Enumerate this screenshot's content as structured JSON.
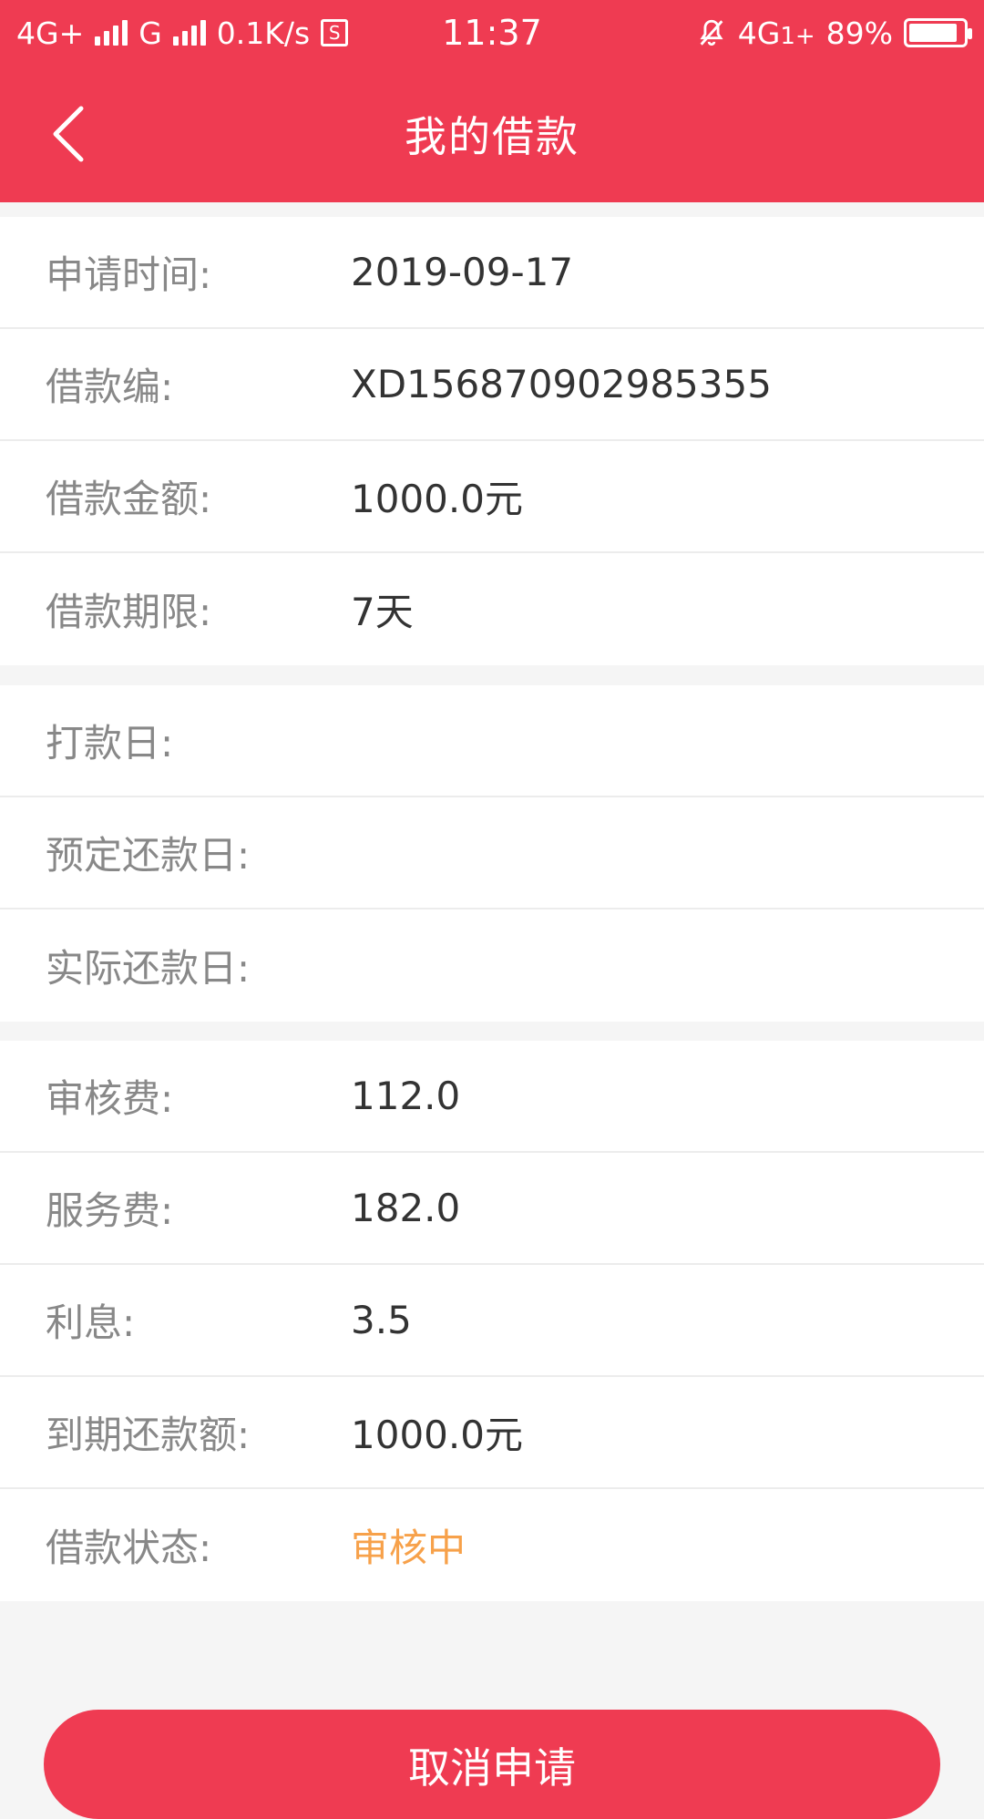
{
  "status_bar": {
    "network1": "4G+",
    "network2": "G",
    "speed": "0.1K/s",
    "sim_icon_label": "S",
    "time": "11:37",
    "network3": "4G",
    "network3_sub": "1+",
    "battery": "89%"
  },
  "header": {
    "title": "我的借款"
  },
  "loan_info": [
    {
      "label": "申请时间:",
      "value": "2019-09-17"
    },
    {
      "label": "借款编:",
      "value": "XD156870902985355"
    },
    {
      "label": "借款金额:",
      "value": "1000.0元"
    },
    {
      "label": "借款期限:",
      "value": "7天"
    }
  ],
  "dates": [
    {
      "label": "打款日:",
      "value": ""
    },
    {
      "label": "预定还款日:",
      "value": ""
    },
    {
      "label": "实际还款日:",
      "value": ""
    }
  ],
  "fees": [
    {
      "label": "审核费:",
      "value": "112.0"
    },
    {
      "label": "服务费:",
      "value": "182.0"
    },
    {
      "label": "利息:",
      "value": "3.5"
    },
    {
      "label": "到期还款额:",
      "value": "1000.0元"
    },
    {
      "label": "借款状态:",
      "value": "审核中"
    }
  ],
  "actions": {
    "cancel_label": "取消申请"
  },
  "colors": {
    "brand": "#ef3b52",
    "status": "#f7a14a"
  }
}
